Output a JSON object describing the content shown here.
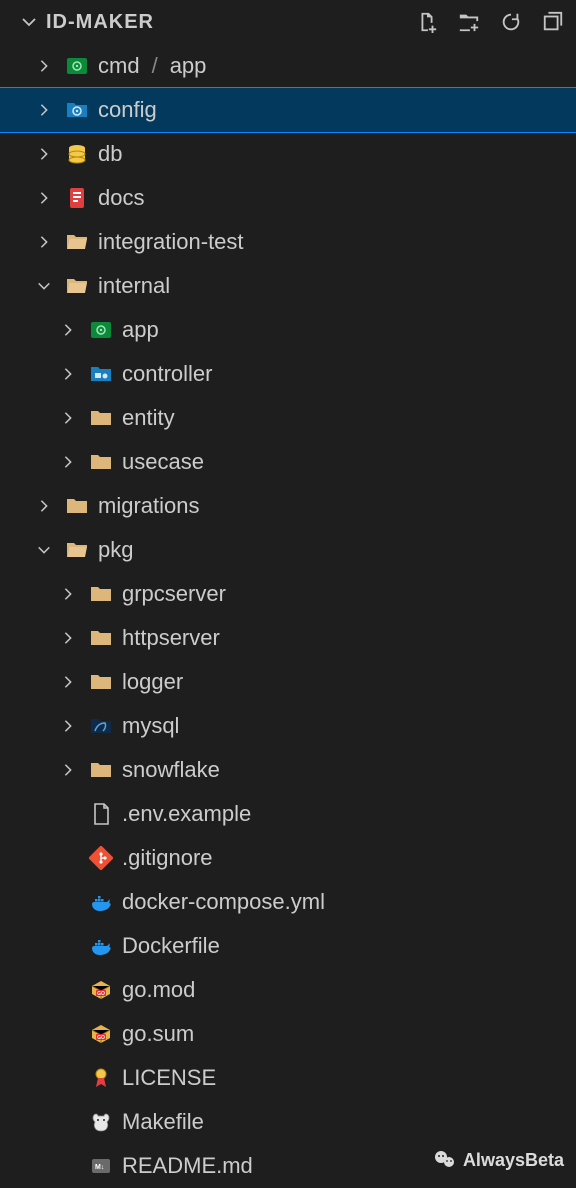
{
  "header": {
    "title": "ID-MAKER"
  },
  "tree": {
    "items": [
      {
        "depth": 0,
        "arrow": "right",
        "icon": "app-gear",
        "label": "cmd",
        "extra": "app",
        "selected": false
      },
      {
        "depth": 0,
        "arrow": "right",
        "icon": "config-gear",
        "label": "config",
        "selected": true
      },
      {
        "depth": 0,
        "arrow": "right",
        "icon": "db",
        "label": "db"
      },
      {
        "depth": 0,
        "arrow": "right",
        "icon": "docs",
        "label": "docs"
      },
      {
        "depth": 0,
        "arrow": "right",
        "icon": "folder-open",
        "label": "integration-test"
      },
      {
        "depth": 0,
        "arrow": "down",
        "icon": "folder-open",
        "label": "internal"
      },
      {
        "depth": 1,
        "arrow": "right",
        "icon": "app-gear",
        "label": "app"
      },
      {
        "depth": 1,
        "arrow": "right",
        "icon": "controller",
        "label": "controller"
      },
      {
        "depth": 1,
        "arrow": "right",
        "icon": "folder",
        "label": "entity"
      },
      {
        "depth": 1,
        "arrow": "right",
        "icon": "folder",
        "label": "usecase"
      },
      {
        "depth": 0,
        "arrow": "right",
        "icon": "folder",
        "label": "migrations"
      },
      {
        "depth": 0,
        "arrow": "down",
        "icon": "folder-open",
        "label": "pkg"
      },
      {
        "depth": 1,
        "arrow": "right",
        "icon": "folder",
        "label": "grpcserver"
      },
      {
        "depth": 1,
        "arrow": "right",
        "icon": "folder",
        "label": "httpserver"
      },
      {
        "depth": 1,
        "arrow": "right",
        "icon": "folder",
        "label": "logger"
      },
      {
        "depth": 1,
        "arrow": "right",
        "icon": "mysql",
        "label": "mysql"
      },
      {
        "depth": 1,
        "arrow": "right",
        "icon": "folder",
        "label": "snowflake"
      },
      {
        "depth": 1,
        "arrow": "none",
        "icon": "file",
        "label": ".env.example"
      },
      {
        "depth": 1,
        "arrow": "none",
        "icon": "git",
        "label": ".gitignore"
      },
      {
        "depth": 1,
        "arrow": "none",
        "icon": "docker",
        "label": "docker-compose.yml"
      },
      {
        "depth": 1,
        "arrow": "none",
        "icon": "docker",
        "label": "Dockerfile"
      },
      {
        "depth": 1,
        "arrow": "none",
        "icon": "go-pkg",
        "label": "go.mod"
      },
      {
        "depth": 1,
        "arrow": "none",
        "icon": "go-pkg",
        "label": "go.sum"
      },
      {
        "depth": 1,
        "arrow": "none",
        "icon": "license",
        "label": "LICENSE"
      },
      {
        "depth": 1,
        "arrow": "none",
        "icon": "makefile",
        "label": "Makefile"
      },
      {
        "depth": 1,
        "arrow": "none",
        "icon": "readme",
        "label": "README.md"
      }
    ]
  },
  "watermark": {
    "text": "AlwaysBeta"
  }
}
